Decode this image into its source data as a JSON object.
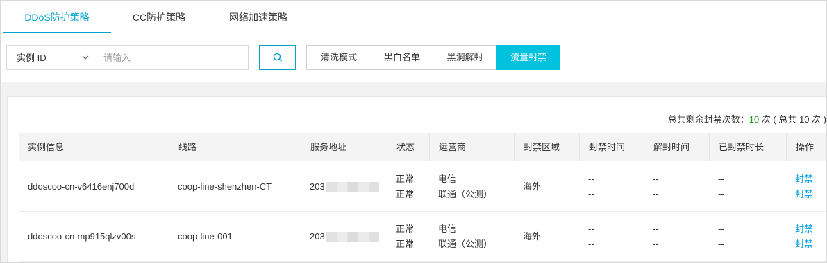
{
  "tabs": [
    "DDoS防护策略",
    "CC防护策略",
    "网络加速策略"
  ],
  "toolbar": {
    "select_value": "实例 ID",
    "search_placeholder": "请输入",
    "segments": [
      "清洗模式",
      "黑白名单",
      "黑洞解封",
      "流量封禁"
    ]
  },
  "summary": {
    "prefix": "总共剩余封禁次数：",
    "count": "10",
    "suffix": " 次 ( 总共 10 次 )"
  },
  "table": {
    "headers": [
      "实例信息",
      "线路",
      "服务地址",
      "状态",
      "运营商",
      "封禁区域",
      "封禁时间",
      "解封时间",
      "已封禁时长",
      "操作"
    ],
    "rows": [
      {
        "instance": "ddoscoo-cn-v6416enj700d",
        "line": "coop-line-shenzhen-CT",
        "address_visible": "203",
        "status": [
          "正常",
          "正常"
        ],
        "isp": [
          "电信",
          "联通（公测）"
        ],
        "region": "海外",
        "ban_time": [
          "--",
          "--"
        ],
        "unban_time": [
          "--",
          "--"
        ],
        "duration": [
          "--",
          "--"
        ],
        "actions": [
          "封禁",
          "封禁"
        ]
      },
      {
        "instance": "ddoscoo-cn-mp915qlzv00s",
        "line": "coop-line-001",
        "address_visible": "203",
        "status": [
          "正常",
          "正常"
        ],
        "isp": [
          "电信",
          "联通（公测）"
        ],
        "region": "海外",
        "ban_time": [
          "--",
          "--"
        ],
        "unban_time": [
          "--",
          "--"
        ],
        "duration": [
          "--",
          "--"
        ],
        "actions": [
          "封禁",
          "封禁"
        ]
      }
    ]
  },
  "colors": {
    "accent": "#00a2ca",
    "active_segment": "#00c1de",
    "link": "#0aa1e4",
    "count": "#1e9d1e"
  }
}
